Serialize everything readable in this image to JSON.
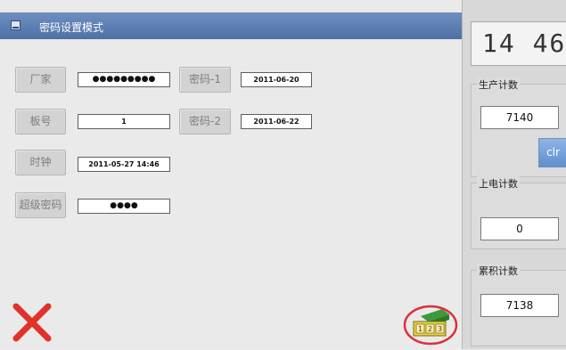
{
  "title_bar": {
    "title": "密码设置模式",
    "icon": "window-icon"
  },
  "fields": [
    {
      "label": "厂家",
      "value": "●●●●●●●●●"
    },
    {
      "label": "板号",
      "value": "1"
    },
    {
      "label": "时钟",
      "value": "2011-05-27 14:46"
    },
    {
      "label": "超级密码",
      "value": "●●●●"
    }
  ],
  "passwords": [
    {
      "label": "密码-1",
      "value": "2011-06-20"
    },
    {
      "label": "密码-2",
      "value": "2011-06-22"
    }
  ],
  "actions": {
    "cancel_icon": "close-icon",
    "confirm_icon": "keypad-icon",
    "confirm_highlight_color": "#d8323c"
  },
  "right_panel": {
    "clock": "14 46",
    "production": {
      "title": "生产计数",
      "value": "7140",
      "clr_label": "clr"
    },
    "power_on": {
      "title": "上电计数",
      "value": "0"
    },
    "cumulative": {
      "title": "累积计数",
      "value": "7138"
    }
  }
}
